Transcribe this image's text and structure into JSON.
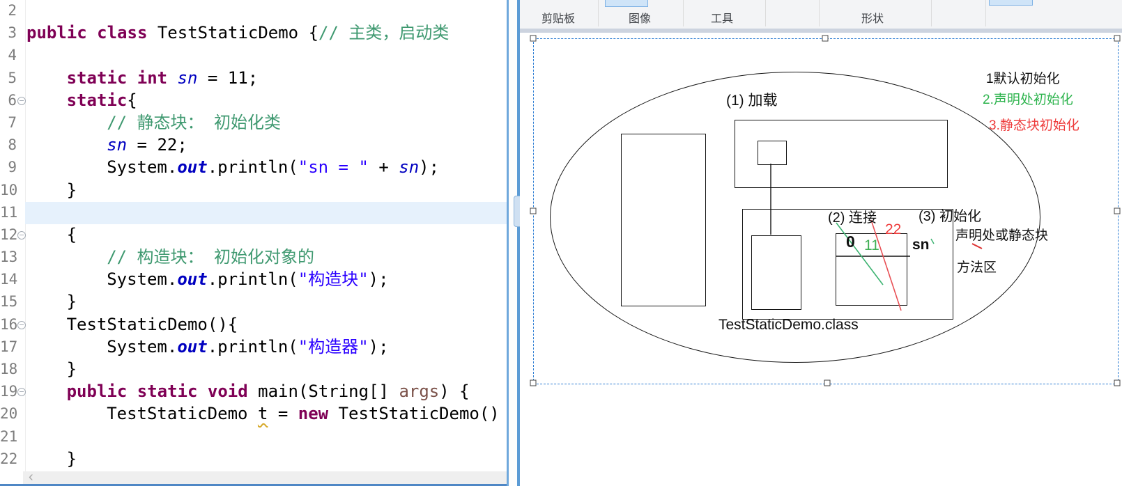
{
  "editor": {
    "hscroll_arrow": "‹",
    "lines": [
      {
        "num": "2",
        "indent": 0,
        "fold": false,
        "current": false,
        "tokens": []
      },
      {
        "num": "3",
        "indent": 0,
        "fold": false,
        "current": false,
        "tokens": [
          [
            "kw",
            "public class "
          ],
          [
            "pl",
            "TestStaticDemo {"
          ],
          [
            "cm",
            "// 主类，启动类"
          ]
        ]
      },
      {
        "num": "4",
        "indent": 0,
        "fold": false,
        "current": false,
        "tokens": []
      },
      {
        "num": "5",
        "indent": 1,
        "fold": false,
        "current": false,
        "tokens": [
          [
            "kw",
            "static int "
          ],
          [
            "fd",
            "sn"
          ],
          [
            "pl",
            " = 11;"
          ]
        ]
      },
      {
        "num": "6",
        "indent": 1,
        "fold": true,
        "current": false,
        "tokens": [
          [
            "kw",
            "static"
          ],
          [
            "pl",
            "{"
          ]
        ]
      },
      {
        "num": "7",
        "indent": 2,
        "fold": false,
        "current": false,
        "tokens": [
          [
            "cm",
            "// 静态块： 初始化类"
          ]
        ]
      },
      {
        "num": "8",
        "indent": 2,
        "fold": false,
        "current": false,
        "tokens": [
          [
            "fd",
            "sn"
          ],
          [
            "pl",
            " = 22;"
          ]
        ]
      },
      {
        "num": "9",
        "indent": 2,
        "fold": false,
        "current": false,
        "tokens": [
          [
            "pl",
            "System."
          ],
          [
            "sf",
            "out"
          ],
          [
            "pl",
            ".println("
          ],
          [
            "st",
            "\"sn = \""
          ],
          [
            "pl",
            " + "
          ],
          [
            "fd",
            "sn"
          ],
          [
            "pl",
            ");"
          ]
        ]
      },
      {
        "num": "10",
        "indent": 1,
        "fold": false,
        "current": false,
        "tokens": [
          [
            "pl",
            "}"
          ]
        ]
      },
      {
        "num": "11",
        "indent": 0,
        "fold": false,
        "current": true,
        "tokens": []
      },
      {
        "num": "12",
        "indent": 1,
        "fold": true,
        "current": false,
        "tokens": [
          [
            "pl",
            "{"
          ]
        ]
      },
      {
        "num": "13",
        "indent": 2,
        "fold": false,
        "current": false,
        "tokens": [
          [
            "cm",
            "// 构造块： 初始化对象的"
          ]
        ]
      },
      {
        "num": "14",
        "indent": 2,
        "fold": false,
        "current": false,
        "tokens": [
          [
            "pl",
            "System."
          ],
          [
            "sf",
            "out"
          ],
          [
            "pl",
            ".println("
          ],
          [
            "st",
            "\"构造块\""
          ],
          [
            "pl",
            ");"
          ]
        ]
      },
      {
        "num": "15",
        "indent": 1,
        "fold": false,
        "current": false,
        "tokens": [
          [
            "pl",
            "}"
          ]
        ]
      },
      {
        "num": "16",
        "indent": 1,
        "fold": true,
        "current": false,
        "tokens": [
          [
            "pl",
            "TestStaticDemo(){"
          ]
        ]
      },
      {
        "num": "17",
        "indent": 2,
        "fold": false,
        "current": false,
        "tokens": [
          [
            "pl",
            "System."
          ],
          [
            "sf",
            "out"
          ],
          [
            "pl",
            ".println("
          ],
          [
            "st",
            "\"构造器\""
          ],
          [
            "pl",
            ");"
          ]
        ]
      },
      {
        "num": "18",
        "indent": 1,
        "fold": false,
        "current": false,
        "tokens": [
          [
            "pl",
            "}"
          ]
        ]
      },
      {
        "num": "19",
        "indent": 1,
        "fold": true,
        "current": false,
        "tokens": [
          [
            "kw",
            "public static void "
          ],
          [
            "pl",
            "main(String[] "
          ],
          [
            "pm",
            "args"
          ],
          [
            "pl",
            ") {"
          ]
        ]
      },
      {
        "num": "20",
        "indent": 2,
        "fold": false,
        "current": false,
        "tokens": [
          [
            "pl",
            "TestStaticDemo "
          ],
          [
            "wv",
            "t"
          ],
          [
            "pl",
            " = "
          ],
          [
            "kw",
            "new"
          ],
          [
            "pl",
            " TestStaticDemo()"
          ]
        ]
      },
      {
        "num": "21",
        "indent": 0,
        "fold": false,
        "current": false,
        "tokens": []
      },
      {
        "num": "22",
        "indent": 1,
        "fold": false,
        "current": false,
        "tokens": [
          [
            "pl",
            "}"
          ]
        ]
      }
    ]
  },
  "ribbon": {
    "groups": [
      {
        "label": "剪贴板"
      },
      {
        "label": "图像"
      },
      {
        "label": "工具"
      },
      {
        "label": "形状"
      }
    ]
  },
  "diagram": {
    "step1": "(1) 加载",
    "step2": "(2) 连接",
    "step3": "(3) 初始化",
    "note1": "1默认初始化",
    "note2": "2.声明处初始化",
    "note3": "3.静态块初始化",
    "val22": "22",
    "val0": "0",
    "val11": "11",
    "sn_label": "sn",
    "decl_label": "声明处或静态块",
    "method_area": "方法区",
    "class_label": "TestStaticDemo.class"
  },
  "colors": {
    "keyword": "#7f0055",
    "comment": "#3f9970",
    "string": "#2a00ff",
    "field": "#0000c0",
    "selection": "#2b7cd3",
    "note_green": "#2eb44e",
    "note_red": "#ee3b3b",
    "line_green": "#3cb371",
    "line_red": "#e85055"
  }
}
